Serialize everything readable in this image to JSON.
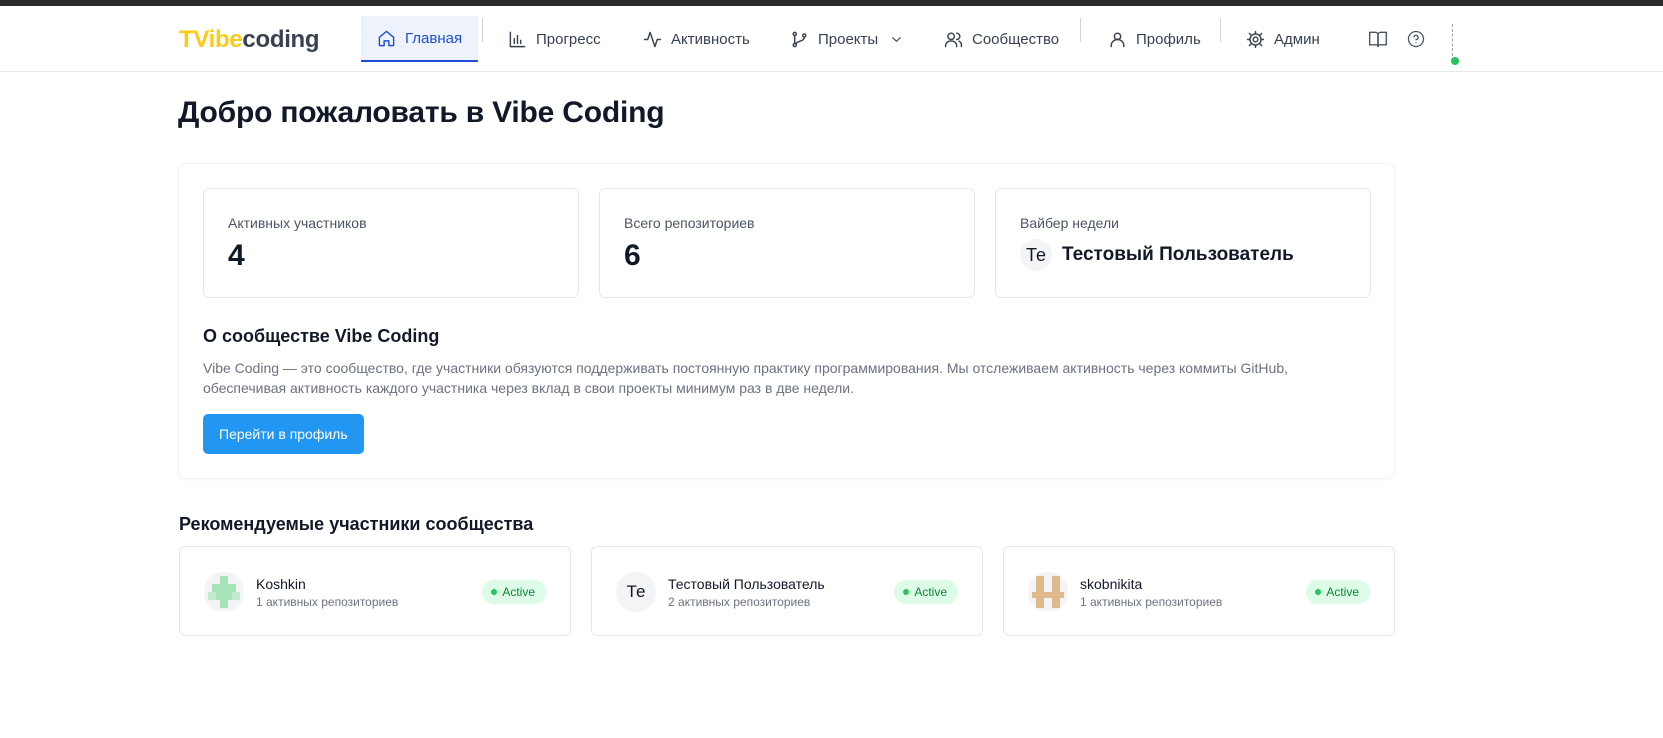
{
  "logo": {
    "part1": "TVibe",
    "part2": "coding"
  },
  "nav": [
    {
      "label": "Главная",
      "icon": "home-icon",
      "active": true
    },
    {
      "label": "Прогресс",
      "icon": "bar-chart-icon"
    },
    {
      "label": "Активность",
      "icon": "activity-icon"
    },
    {
      "label": "Проекты",
      "icon": "git-branch-icon",
      "dropdown": true
    },
    {
      "label": "Сообщество",
      "icon": "users-icon"
    },
    {
      "label": "Профиль",
      "icon": "user-icon"
    },
    {
      "label": "Админ",
      "icon": "settings-icon"
    }
  ],
  "toolbar": {
    "docs_icon": "book-icon",
    "help_icon": "help-circle-icon"
  },
  "page": {
    "title": "Добро пожаловать в Vibe Coding"
  },
  "stats": {
    "active_members": {
      "label": "Активных участников",
      "value": "4"
    },
    "repos": {
      "label": "Всего репозиториев",
      "value": "6"
    },
    "viber": {
      "label": "Вайбер недели",
      "initials": "Те",
      "name": "Тестовый Пользователь"
    }
  },
  "about": {
    "title": "О сообществе Vibe Coding",
    "text": "Vibe Coding — это сообщество, где участники обязуются поддерживать постоянную практику программирования. Мы отслеживаем активность через коммиты GitHub, обеспечивая активность каждого участника через вклад в свои проекты минимум раз в две недели.",
    "button": "Перейти в профиль"
  },
  "recommended": {
    "title": "Рекомендуемые участники сообщества",
    "members": [
      {
        "name": "Koshkin",
        "repos": "1 активных репозиториев",
        "status": "Active",
        "avatar": "identicon-green"
      },
      {
        "name": "Тестовый Пользователь",
        "repos": "2 активных репозиториев",
        "status": "Active",
        "initials": "Те"
      },
      {
        "name": "skobnikita",
        "repos": "1 активных репозиториев",
        "status": "Active",
        "avatar": "identicon-tan"
      }
    ]
  },
  "colors": {
    "accent": "#1d4ed8",
    "button": "#2196f3",
    "logo_yellow": "#facc15",
    "active_badge_bg": "#dcfce7",
    "active_badge_text": "#15803d",
    "status_dot": "#22c55e"
  }
}
